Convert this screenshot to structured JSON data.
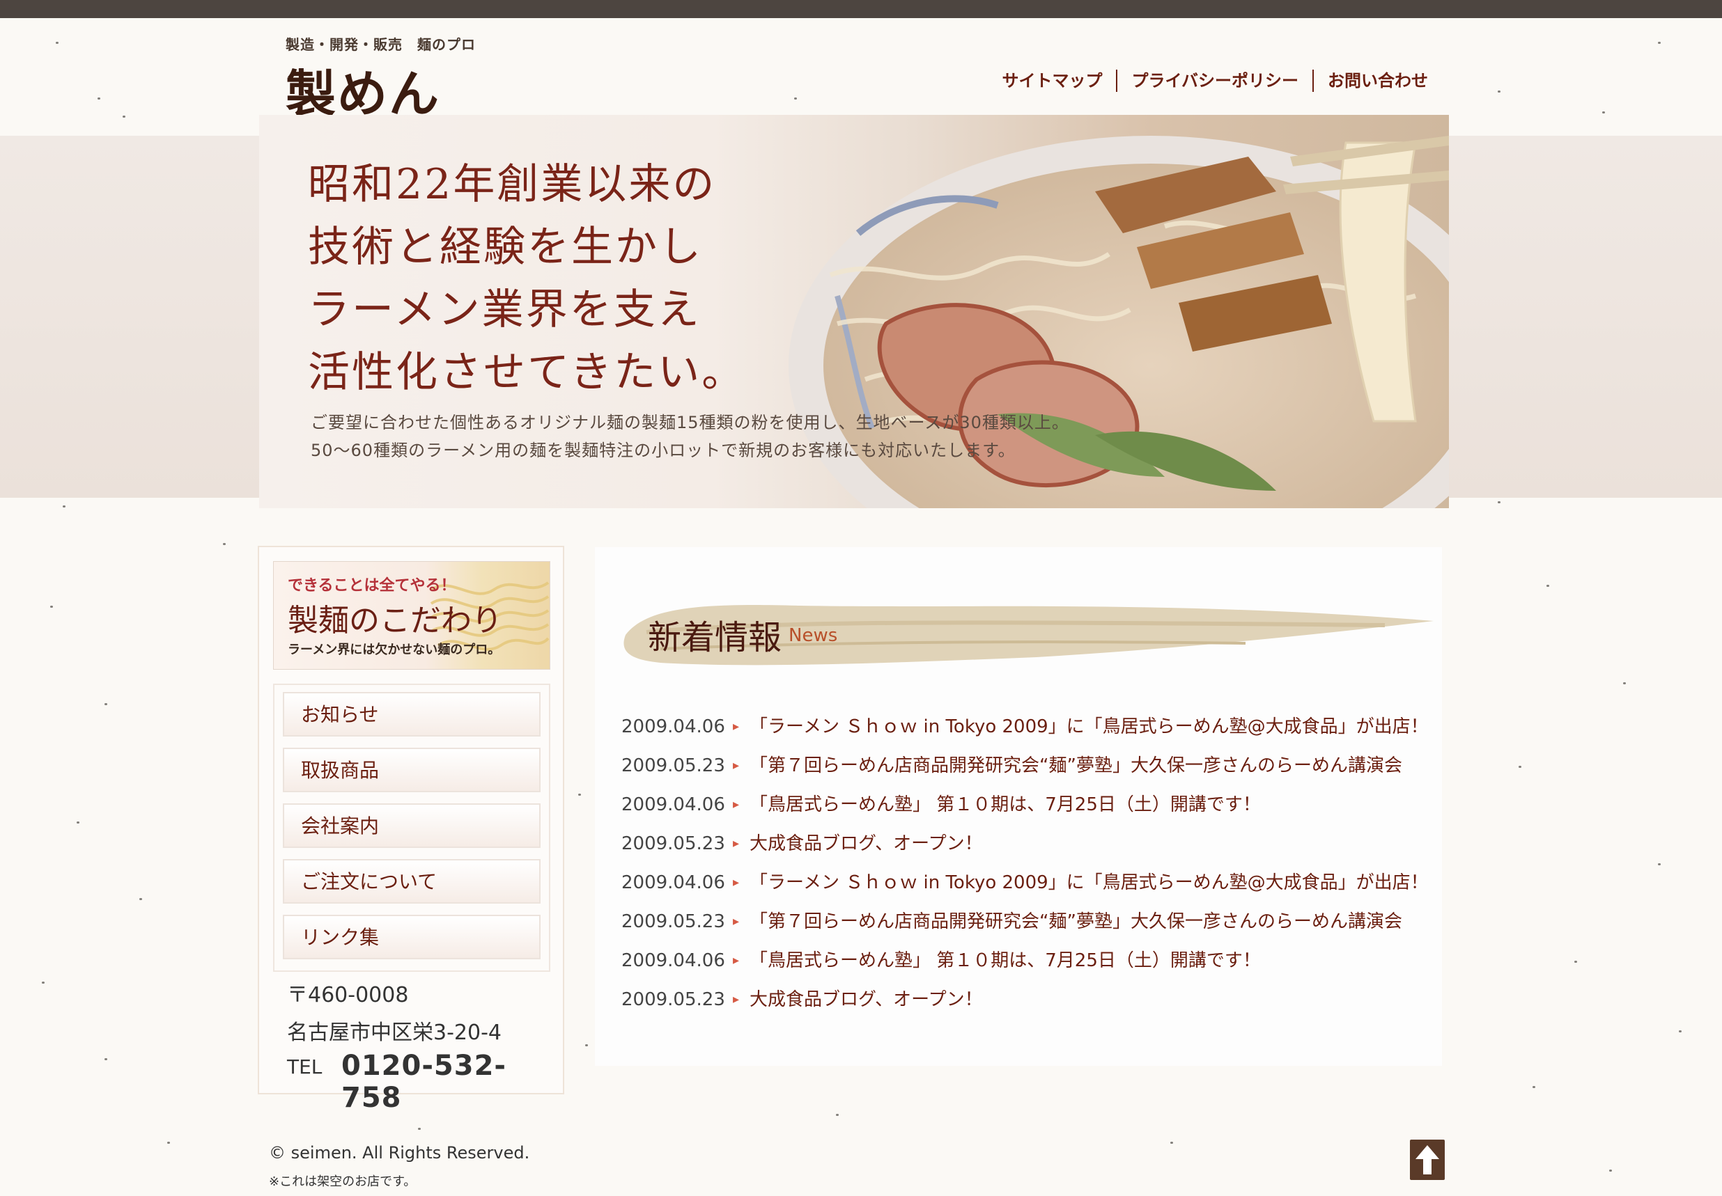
{
  "header": {
    "tagline": "製造・開発・販売　麺のプロ",
    "logo": "製めん",
    "nav": [
      "サイトマップ",
      "プライバシーポリシー",
      "お問い合わせ"
    ]
  },
  "hero": {
    "lines": [
      "昭和22年創業以来の",
      "技術と経験を生かし",
      "ラーメン業界を支え",
      "活性化させてきたい。"
    ],
    "sub1": "ご要望に合わせた個性あるオリジナル麺の製麺15種類の粉を使用し、生地ベースが30種類以上。",
    "sub2": "50〜60種類のラーメン用の麺を製麺特注の小ロットで新規のお客様にも対応いたします。"
  },
  "sidebar": {
    "banner": {
      "small": "できることは全てやる！",
      "big": "製麺のこだわり",
      "note": "ラーメン界には欠かせない麺のプロ。"
    },
    "menu": [
      "お知らせ",
      "取扱商品",
      "会社案内",
      "ご注文について",
      "リンク集"
    ],
    "postal": "〒460-0008",
    "address": "名古屋市中区栄3-20-4",
    "tel_label": "TEL",
    "tel": "0120-532-758"
  },
  "news": {
    "title": "新着情報",
    "title_en": "News",
    "items": [
      {
        "date": "2009.04.06",
        "text": "「ラーメン Ｓｈｏｗ in Tokyo 2009」に「鳥居式らーめん塾@大成食品」が出店！"
      },
      {
        "date": "2009.05.23",
        "text": "「第７回らーめん店商品開発研究会“麺”夢塾」大久保一彦さんのらーめん講演会"
      },
      {
        "date": "2009.04.06",
        "text": "「鳥居式らーめん塾」 第１０期は、7月25日（土）開講です！"
      },
      {
        "date": "2009.05.23",
        "text": "大成食品ブログ、オープン！"
      },
      {
        "date": "2009.04.06",
        "text": "「ラーメン Ｓｈｏｗ in Tokyo 2009」に「鳥居式らーめん塾@大成食品」が出店！"
      },
      {
        "date": "2009.05.23",
        "text": "「第７回らーめん店商品開発研究会“麺”夢塾」大久保一彦さんのらーめん講演会"
      },
      {
        "date": "2009.04.06",
        "text": "「鳥居式らーめん塾」 第１０期は、7月25日（土）開講です！"
      },
      {
        "date": "2009.05.23",
        "text": "大成食品ブログ、オープン！"
      }
    ]
  },
  "footer": {
    "copyright": "© seimen. All Rights Reserved.",
    "note": "※これは架空のお店です。"
  },
  "colors": {
    "accent": "#6b1f10",
    "topbar": "#4d4540",
    "background": "#fbf9f5"
  },
  "icons": {
    "arrow": "triangle-right-icon",
    "totop": "arrow-up-icon"
  }
}
